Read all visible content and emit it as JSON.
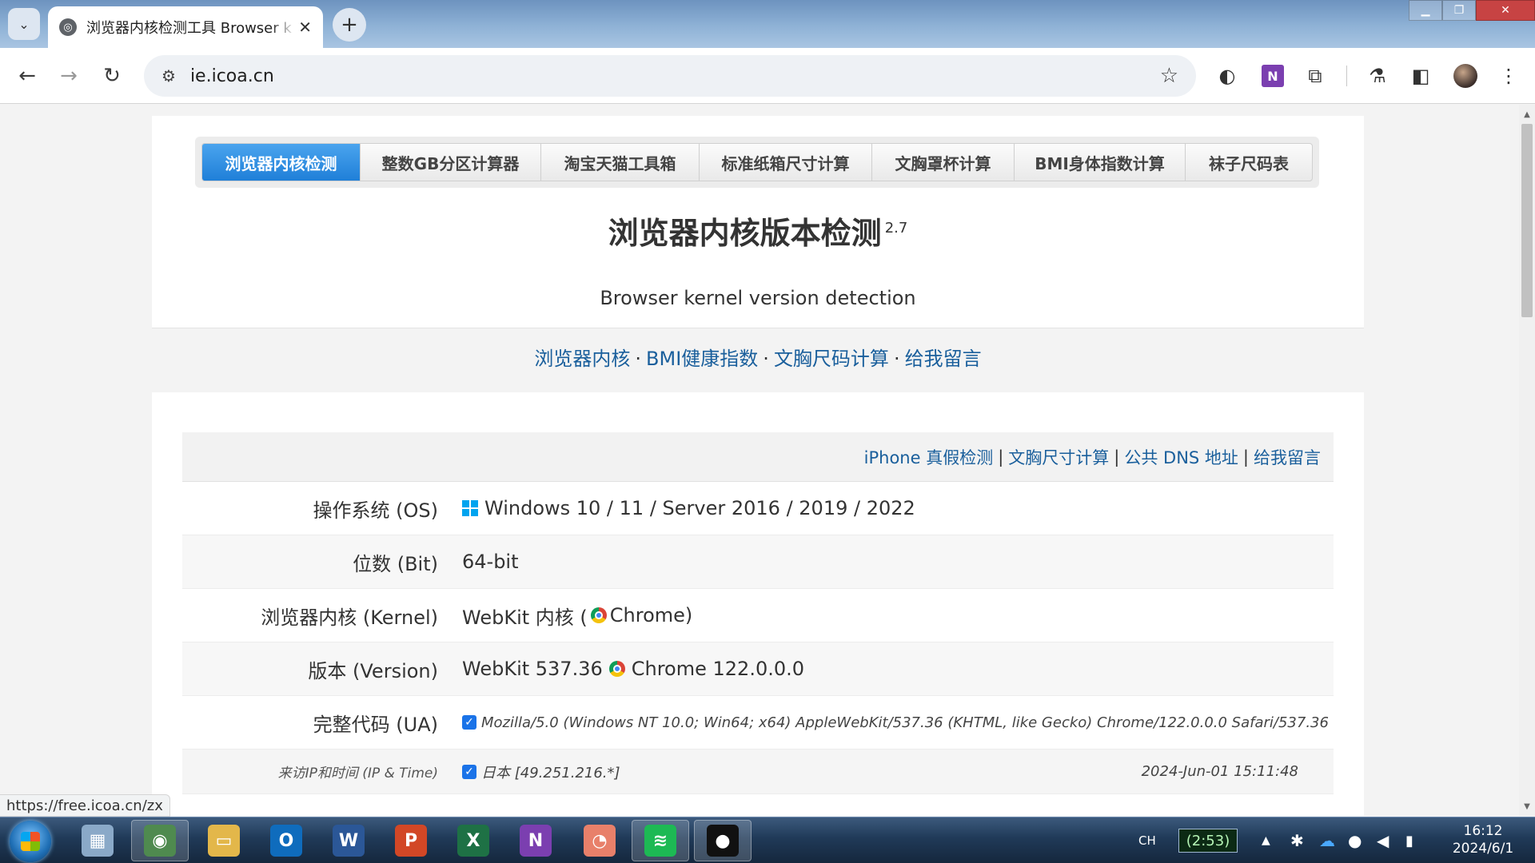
{
  "browser": {
    "tab_title": "浏览器内核检测工具 Browser k",
    "tab_close": "✕",
    "new_tab": "+",
    "url": "ie.icoa.cn",
    "status_url": "https://free.icoa.cn/zx"
  },
  "menu": {
    "items": [
      "浏览器内核检测",
      "整数GB分区计算器",
      "淘宝天猫工具箱",
      "标准纸箱尺寸计算",
      "文胸罩杯计算",
      "BMI身体指数计算",
      "袜子尺码表"
    ],
    "active_index": 0
  },
  "header": {
    "title": "浏览器内核版本检测",
    "version": "2.7",
    "subtitle": "Browser kernel version detection"
  },
  "quicklinks": [
    "浏览器内核",
    "BMI健康指数",
    "文胸尺码计算",
    "给我留言"
  ],
  "table": {
    "toplinks": [
      "iPhone 真假检测",
      "文胸尺寸计算",
      "公共 DNS 地址",
      "给我留言"
    ],
    "rows": {
      "os": {
        "label": "操作系统 (OS)",
        "value": "Windows 10 / 11 / Server 2016 / 2019 / 2022"
      },
      "bit": {
        "label": "位数 (Bit)",
        "value": "64-bit"
      },
      "kernel": {
        "label": "浏览器内核 (Kernel)",
        "value_prefix": "WebKit 内核 (",
        "value_suffix": "Chrome)"
      },
      "version": {
        "label": "版本 (Version)",
        "value_prefix": "WebKit 537.36",
        "value_suffix": "Chrome 122.0.0.0"
      },
      "ua": {
        "label": "完整代码 (UA)",
        "value": "Mozilla/5.0 (Windows NT 10.0; Win64; x64) AppleWebKit/537.36 (KHTML, like Gecko) Chrome/122.0.0.0 Safari/537.36"
      },
      "ip": {
        "label": "来访IP和时间 (IP & Time)",
        "value": "日本 [49.251.216.*]",
        "time": "2024-Jun-01 15:11:48"
      }
    }
  },
  "taskbar": {
    "apps": [
      {
        "name": "calculator",
        "glyph": "▦",
        "color": "#8aa9c8"
      },
      {
        "name": "chrome",
        "glyph": "◉",
        "color": "#4f8a4f"
      },
      {
        "name": "explorer",
        "glyph": "▭",
        "color": "#e3b74a"
      },
      {
        "name": "outlook",
        "glyph": "O",
        "color": "#0f6cbd"
      },
      {
        "name": "word",
        "glyph": "W",
        "color": "#2b5797"
      },
      {
        "name": "powerpoint",
        "glyph": "P",
        "color": "#d24726"
      },
      {
        "name": "excel",
        "glyph": "X",
        "color": "#1e7145"
      },
      {
        "name": "onenote",
        "glyph": "N",
        "color": "#7b3fb0"
      },
      {
        "name": "chart-app",
        "glyph": "◔",
        "color": "#e8806a"
      },
      {
        "name": "spotify",
        "glyph": "≋",
        "color": "#1db954"
      },
      {
        "name": "qq",
        "glyph": "●",
        "color": "#111111"
      }
    ],
    "ime": "CH",
    "battery": "(2:53)",
    "clock_time": "16:12",
    "clock_date": "2024/6/1"
  },
  "colors": {
    "link": "#1a5f9c",
    "menu_active": "#2b8de3"
  }
}
